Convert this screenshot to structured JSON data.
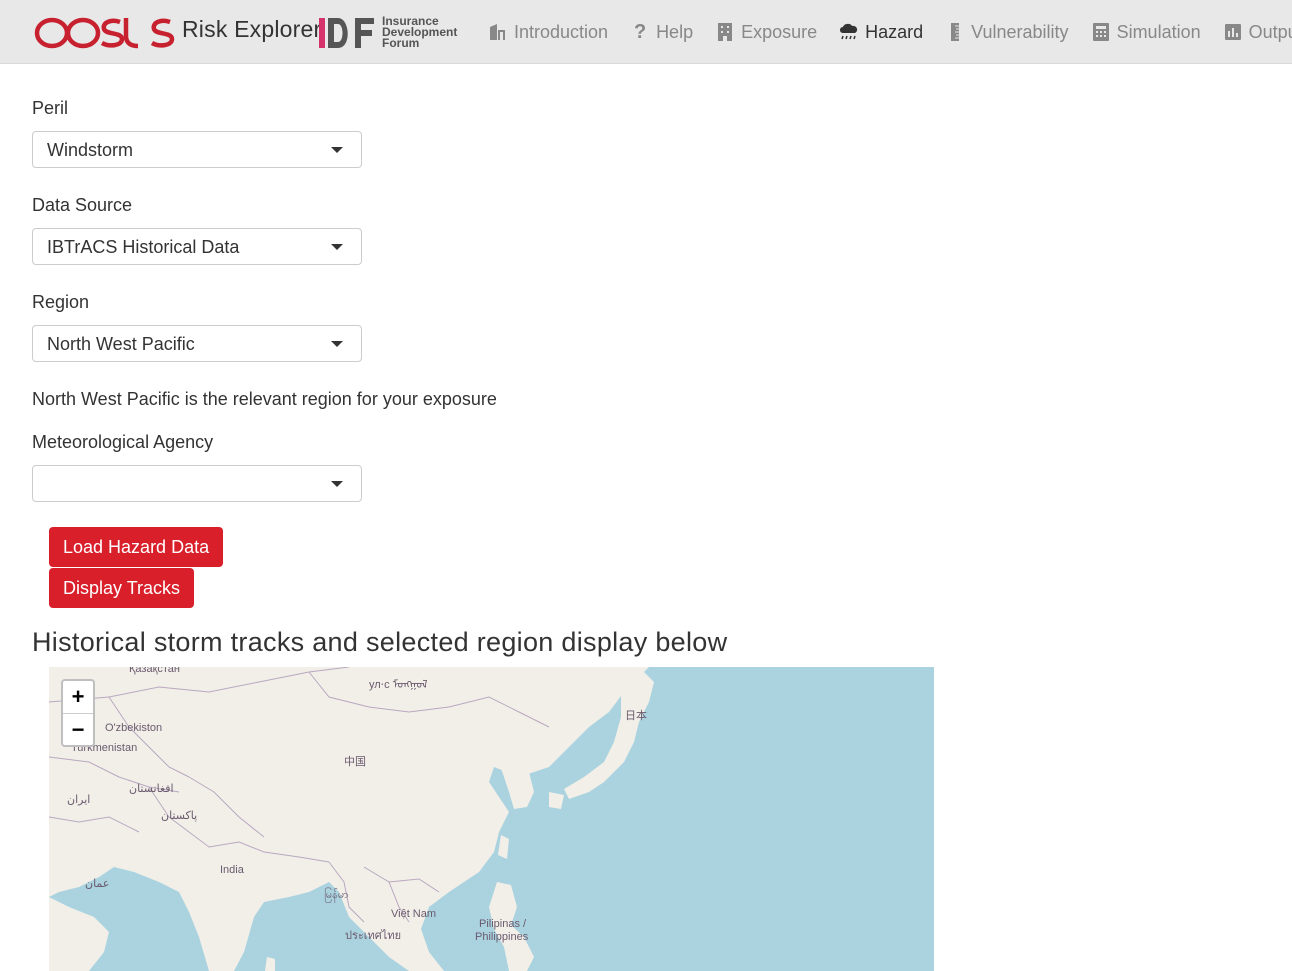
{
  "header": {
    "logo_text": "oasis",
    "app_title": "Risk Explorer",
    "partner_logo_letters": "IDF",
    "partner_logo_lines": [
      "Insurance",
      "Development",
      "Forum"
    ],
    "nav": [
      {
        "label": "Introduction",
        "icon": "building-icon",
        "active": false
      },
      {
        "label": "Help",
        "icon": "question-icon",
        "active": false
      },
      {
        "label": "Exposure",
        "icon": "tall-building-icon",
        "active": false
      },
      {
        "label": "Hazard",
        "icon": "cloud-rain-icon",
        "active": true
      },
      {
        "label": "Vulnerability",
        "icon": "ruler-icon",
        "active": false
      },
      {
        "label": "Simulation",
        "icon": "calculator-icon",
        "active": false
      },
      {
        "label": "Output",
        "icon": "bar-chart-icon",
        "active": false
      }
    ]
  },
  "form": {
    "peril": {
      "label": "Peril",
      "value": "Windstorm"
    },
    "data_source": {
      "label": "Data Source",
      "value": "IBTrACS Historical Data"
    },
    "region": {
      "label": "Region",
      "value": "North West Pacific"
    },
    "region_note": "North West Pacific is the relevant region for your exposure",
    "agency": {
      "label": "Meteorological Agency",
      "value": ""
    }
  },
  "buttons": {
    "load": "Load Hazard Data",
    "display": "Display Tracks"
  },
  "map_section": {
    "title": "Historical storm tracks and selected region display below",
    "zoom_in": "+",
    "zoom_out": "−",
    "labels": [
      "Қазақстан",
      "ул⋅с ᠮᠣᠩᠭᠣᠯ",
      "日本",
      "O'zbekiston",
      "Turkmenistan",
      "中国",
      "ایران",
      "افغانستان",
      "پاکستان",
      "India",
      "عمان",
      "မြန်မာ",
      "Việt Nam",
      "ประเทศไทย",
      "Pilipinas /",
      "Philippines"
    ]
  },
  "colors": {
    "accent": "#d81f2a",
    "oasis_red": "#c7202f",
    "idf_pink": "#d6336c",
    "water": "#aad3df",
    "land": "#f2efe9"
  }
}
